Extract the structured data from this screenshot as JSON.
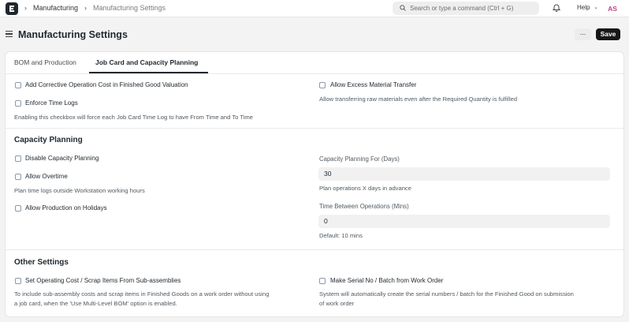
{
  "navbar": {
    "breadcrumbs": [
      "Manufacturing",
      "Manufacturing Settings"
    ],
    "search_placeholder": "Search or type a command (Ctrl + G)",
    "help_label": "Help",
    "avatar_initials": "AS"
  },
  "page": {
    "title": "Manufacturing Settings",
    "more_label": "...",
    "save_label": "Save"
  },
  "tabs": [
    {
      "label": "BOM and Production",
      "active": false
    },
    {
      "label": "Job Card and Capacity Planning",
      "active": true
    }
  ],
  "general": {
    "corrective_cost_label": "Add Corrective Operation Cost in Finished Good Valuation",
    "enforce_time_logs_label": "Enforce Time Logs",
    "enforce_time_logs_desc": "Enabling this checkbox will force each Job Card Time Log to have From Time and To Time",
    "allow_excess_label": "Allow Excess Material Transfer",
    "allow_excess_desc": "Allow transferring raw materials even after the Required Quantity is fulfilled"
  },
  "capacity": {
    "title": "Capacity Planning",
    "disable_label": "Disable Capacity Planning",
    "overtime_label": "Allow Overtime",
    "overtime_desc": "Plan time logs outside Workstation working hours",
    "holidays_label": "Allow Production on Holidays",
    "days_label": "Capacity Planning For (Days)",
    "days_value": "30",
    "days_desc": "Plan operations X days in advance",
    "between_label": "Time Between Operations (Mins)",
    "between_value": "0",
    "between_desc": "Default: 10 mins"
  },
  "other": {
    "title": "Other Settings",
    "opcost_label": "Set Operating Cost / Scrap Items From Sub-assemblies",
    "opcost_desc_1": "To include sub-assembly costs and scrap items in Finished Goods on a work order without using",
    "opcost_desc_2": "a job card, when the 'Use Multi-Level BOM' option is enabled.",
    "serial_label": "Make Serial No / Batch from Work Order",
    "serial_desc_1": "System will automatically create the serial numbers / batch for the Finished Good on submission",
    "serial_desc_2": "of work order"
  }
}
